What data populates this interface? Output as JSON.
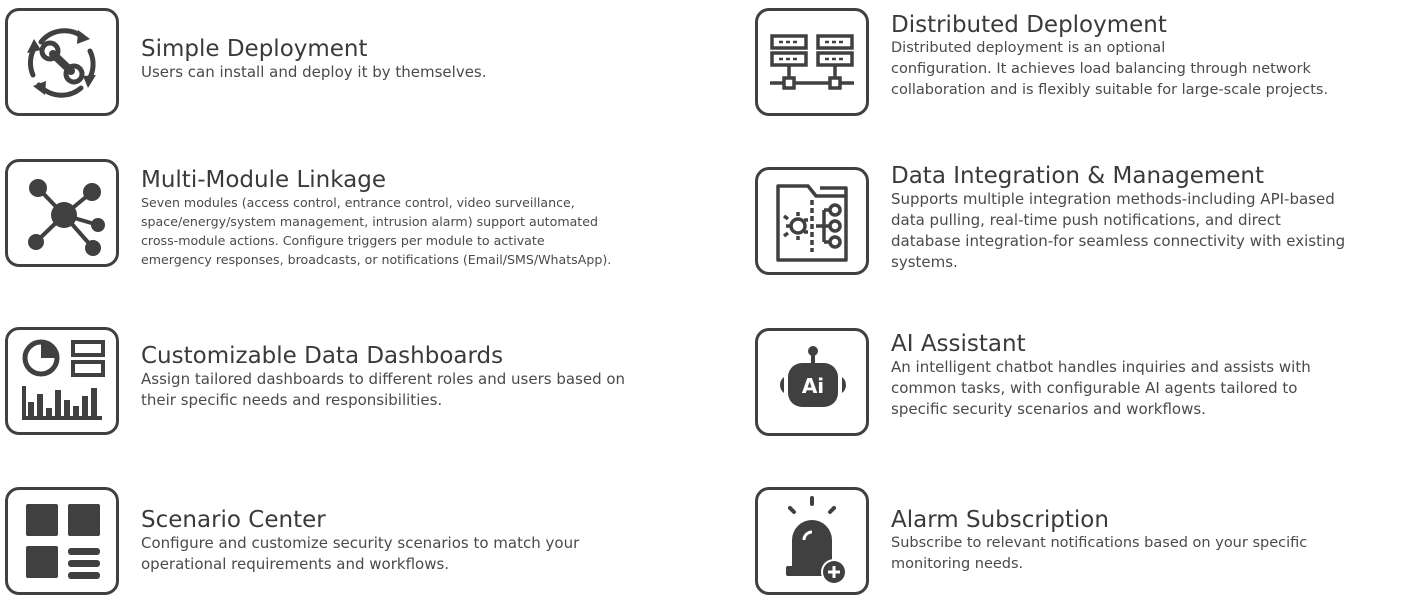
{
  "features": [
    {
      "title": "Simple Deployment",
      "icon": "wrench-cycle-icon",
      "lines": [
        "Users can install and deploy it by themselves."
      ]
    },
    {
      "title": "Multi-Module Linkage",
      "icon": "network-hub-icon",
      "lines": [
        "Seven modules (access control, entrance control, video surveillance,",
        "space/energy/system management, intrusion alarm) support automated",
        "cross-module actions. Configure triggers per module to activate",
        "emergency responses, broadcasts, or notifications (Email/SMS/WhatsApp)."
      ]
    },
    {
      "title": "Customizable Data Dashboards",
      "icon": "dashboard-icon",
      "lines": [
        "Assign tailored dashboards to different roles and users based on",
        "their specific needs and responsibilities."
      ]
    },
    {
      "title": "Scenario Center",
      "icon": "scenario-grid-icon",
      "lines": [
        "Configure and customize security scenarios to match your",
        "operational requirements and workflows."
      ]
    },
    {
      "title": "Distributed Deployment",
      "icon": "distributed-servers-icon",
      "lines": [
        "Distributed deployment is an optional",
        "configuration. It achieves load balancing through network",
        "collaboration and is flexibly suitable for large-scale projects."
      ]
    },
    {
      "title": "Data Integration & Management",
      "icon": "data-integration-icon",
      "lines": [
        "Supports multiple integration methods-including API-based",
        "data pulling, real-time push notifications, and direct",
        "database integration-for seamless connectivity with existing",
        "systems."
      ]
    },
    {
      "title": "AI Assistant",
      "icon": "ai-robot-icon",
      "lines": [
        "An intelligent chatbot handles inquiries and assists with",
        "common tasks, with configurable AI agents tailored to",
        "specific security scenarios and workflows."
      ]
    },
    {
      "title": "Alarm Subscription",
      "icon": "alarm-subscribe-icon",
      "lines": [
        "Subscribe to relevant notifications based on your specific",
        "monitoring needs."
      ]
    }
  ],
  "colors": {
    "icon": "#404040",
    "text": "#3a3a3a"
  }
}
